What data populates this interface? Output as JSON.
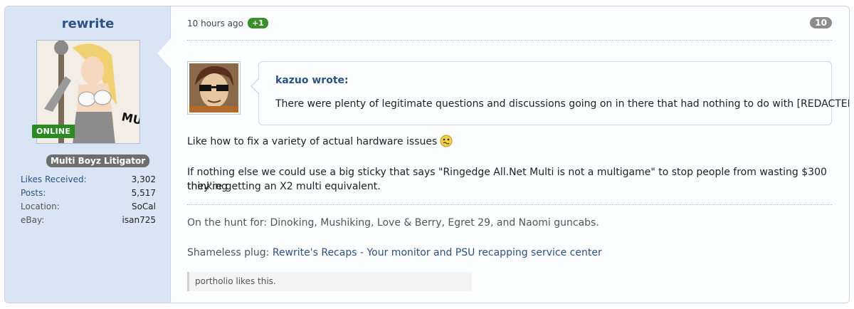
{
  "user": {
    "username": "rewrite",
    "online_label": "ONLINE",
    "title": "Multi Boyz Litigator",
    "avatar_text": "MULTI BOYZ",
    "stats": [
      {
        "label": "Likes Received:",
        "value": "3,302"
      },
      {
        "label": "Posts:",
        "value": "5,517"
      },
      {
        "label": "Location:",
        "value": "SoCal"
      },
      {
        "label": "eBay:",
        "value": "isan725"
      }
    ]
  },
  "post": {
    "time": "10 hours ago",
    "rating": "+1",
    "number": "10",
    "quote": {
      "author": "kazuo wrote:",
      "text": "There were plenty of legitimate questions and discussions going on in there that had nothing to do with [REDACTED]."
    },
    "body": {
      "line1": "Like how to fix a variety of actual hardware issues",
      "line2": "If nothing else we could use a big sticky that says \"Ringedge All.Net Multi is not a multigame\" to stop people from wasting $300 thinking",
      "line3": "they're getting an X2 multi equivalent."
    },
    "signature": {
      "hunt": "On the hunt for: Dinoking, Mushiking, Love & Berry, Egret 29, and Naomi guncabs.",
      "plug_prefix": "Shameless plug:",
      "plug_link": "Rewrite's Recaps - Your monitor and PSU recapping service center"
    },
    "likes_text": "portholio likes this."
  },
  "colors": {
    "sidebar_bg": "#d9e5f4",
    "link": "#2c5282",
    "online_green": "#2a8a24",
    "rating_green": "#3a8f2a"
  }
}
